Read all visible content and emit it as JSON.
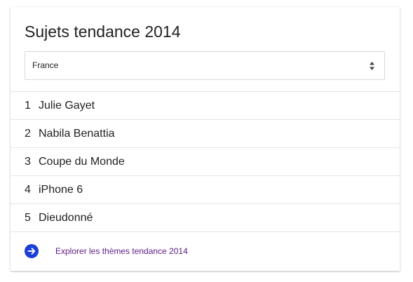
{
  "card": {
    "title": "Sujets tendance 2014"
  },
  "country_select": {
    "value": "France",
    "icon": "updown-arrows-icon"
  },
  "trending": [
    {
      "rank": "1",
      "label": "Julie Gayet"
    },
    {
      "rank": "2",
      "label": "Nabila Benattia"
    },
    {
      "rank": "3",
      "label": "Coupe du Monde"
    },
    {
      "rank": "4",
      "label": "iPhone 6"
    },
    {
      "rank": "5",
      "label": "Dieudonné"
    }
  ],
  "footer": {
    "icon": "arrow-right-circle-icon",
    "link_text": "Explorer les thèmes tendance 2014",
    "icon_color": "#1a3fd6",
    "link_color": "#5b1a86"
  }
}
